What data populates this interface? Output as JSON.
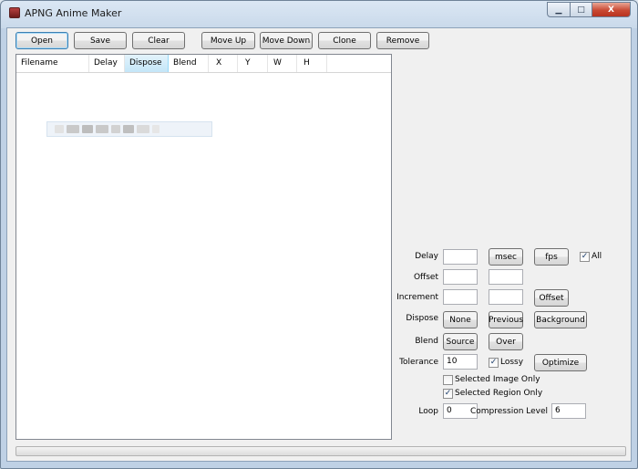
{
  "app": {
    "title": "APNG Anime Maker"
  },
  "window_controls": {
    "minimize": "▁",
    "maximize": "□",
    "close": "X"
  },
  "toolbar": {
    "open": "Open",
    "save": "Save",
    "clear": "Clear",
    "move_up": "Move Up",
    "move_down": "Move Down",
    "clone": "Clone",
    "remove": "Remove"
  },
  "frame_list": {
    "columns": [
      "Filename",
      "Delay",
      "Dispose",
      "Blend",
      "X",
      "Y",
      "W",
      "H"
    ],
    "sorted_column": "Dispose",
    "rows": []
  },
  "props": {
    "delay_label": "Delay",
    "delay_value": "",
    "msec": "msec",
    "fps": "fps",
    "all_label": "All",
    "all_checked": true,
    "offset_label": "Offset",
    "offset_x": "",
    "offset_y": "",
    "increment_label": "Increment",
    "increment_x": "",
    "increment_y": "",
    "offset_button": "Offset",
    "dispose_label": "Dispose",
    "dispose_none": "None",
    "dispose_previous": "Previous",
    "dispose_background": "Background",
    "blend_label": "Blend",
    "blend_source": "Source",
    "blend_over": "Over",
    "tolerance_label": "Tolerance",
    "tolerance_value": "10",
    "lossy_label": "Lossy",
    "lossy_checked": true,
    "optimize": "Optimize",
    "selected_image_only_label": "Selected Image Only",
    "selected_image_only_checked": false,
    "selected_region_only_label": "Selected Region Only",
    "selected_region_only_checked": true,
    "loop_label": "Loop",
    "loop_value": "0",
    "compression_label": "Compression Level",
    "compression_value": "6"
  },
  "status": {
    "progress": 0
  },
  "colors": {
    "progress_fill": "#37b44a",
    "accent": "#3c7fb1"
  }
}
